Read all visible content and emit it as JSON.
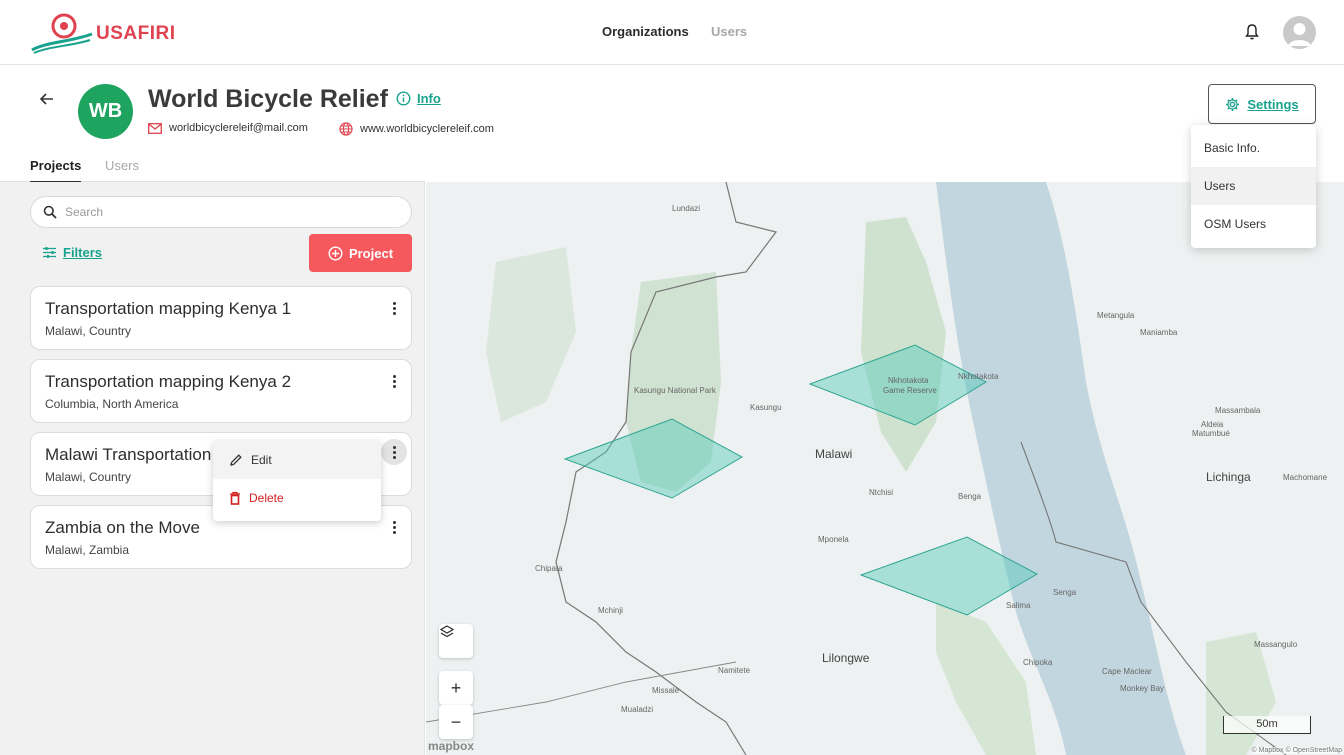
{
  "brand": {
    "name": "USAFIRI",
    "accent": "#e0424f",
    "teal": "#19a38e"
  },
  "topnav": {
    "organizations": "Organizations",
    "users": "Users"
  },
  "org": {
    "initials": "WB",
    "name": "World Bicycle Relief",
    "info_label": "Info",
    "email": "worldbicyclereleif@mail.com",
    "website": "www.worldbicyclereleif.com",
    "avatar_color": "#1fa460"
  },
  "settings": {
    "label": "Settings",
    "menu": [
      "Basic Info.",
      "Users",
      "OSM Users"
    ]
  },
  "tabs": {
    "projects": "Projects",
    "users": "Users"
  },
  "search": {
    "placeholder": "Search",
    "value": ""
  },
  "filters_label": "Filters",
  "add_project_label": "Project",
  "projects": [
    {
      "title": "Transportation mapping Kenya 1",
      "location": "Malawi, Country"
    },
    {
      "title": "Transportation mapping Kenya 2",
      "location": "Columbia, North America"
    },
    {
      "title": "Malawi Transportation",
      "location": "Malawi, Country"
    },
    {
      "title": "Zambia on the Move",
      "location": "Malawi, Zambia"
    }
  ],
  "context_menu": {
    "edit": "Edit",
    "delete": "Delete"
  },
  "map": {
    "labels": {
      "lundazi": "Lundazi",
      "kasungu_np": "Kasungu National Park",
      "kasungu": "Kasungu",
      "nkhotakota_gr_1": "Nkhotakota",
      "nkhotakota_gr_2": "Game Reserve",
      "nkhotakota": "Nkhotakota",
      "malawi": "Malawi",
      "ntchisi": "Ntchisi",
      "benga": "Benga",
      "mponela": "Mponela",
      "chipata": "Chipata",
      "mchinji": "Mchinji",
      "salima": "Salima",
      "senga": "Senga",
      "lilongwe": "Lilongwe",
      "namitete": "Namitete",
      "missale": "Missale",
      "mualadzi": "Mualadzi",
      "chipoka": "Chipoka",
      "metangula": "Metangula",
      "maniamba": "Maniamba",
      "massambala": "Massambala",
      "aldeia": "Aldeia",
      "matumbue": "Matumbué",
      "lichinga": "Lichinga",
      "machomane": "Machomane",
      "massangulo": "Massangulo",
      "cape_maclear": "Cape Maclear",
      "monkey_bay": "Monkey Bay"
    },
    "scale": "50m",
    "attribution": "© Mapbox © OpenStreetMap",
    "logo": "mapbox",
    "zoom_in": "+",
    "zoom_out": "−"
  }
}
